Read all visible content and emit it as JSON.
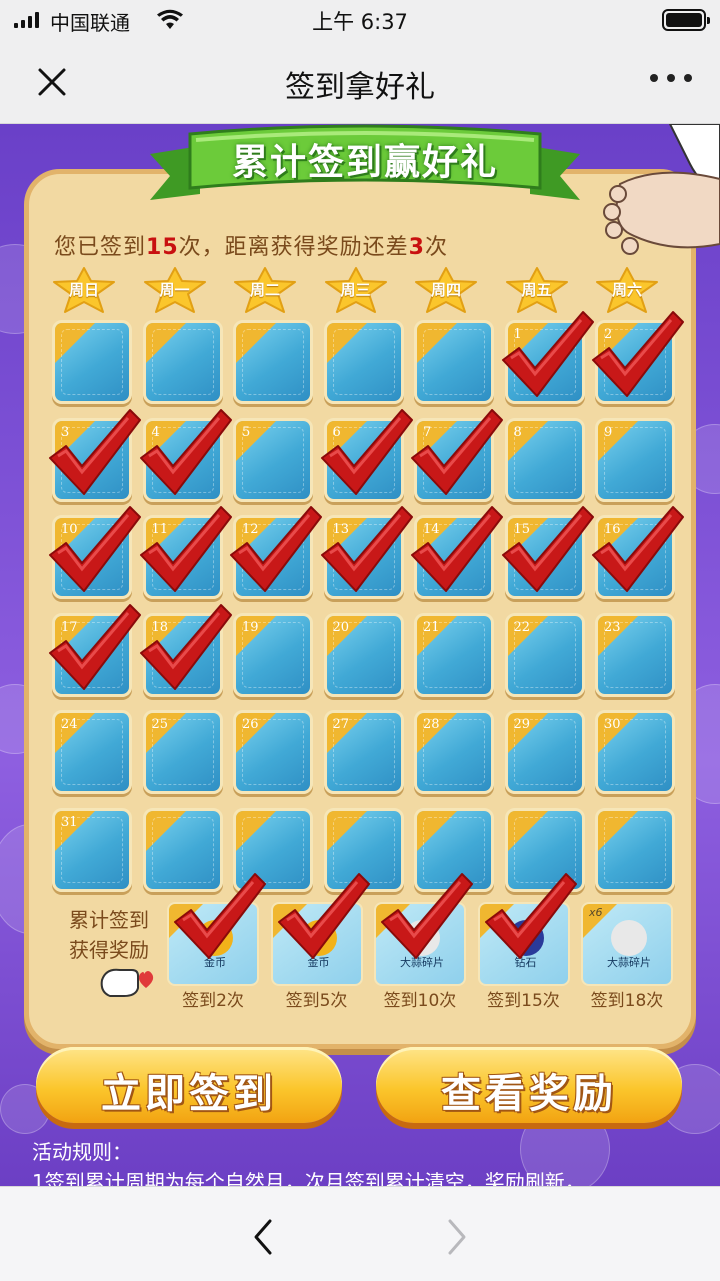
{
  "status_bar": {
    "carrier": "中国联通",
    "time": "上午 6:37"
  },
  "nav": {
    "title": "签到拿好礼",
    "close_icon": "close-icon",
    "more_icon": "more-icon"
  },
  "board": {
    "banner": "累计签到赢好礼",
    "signed_prefix": "您已签到",
    "signed_count": "15",
    "signed_mid": "次，距离获得奖励还差",
    "remaining": "3",
    "signed_suffix": "次"
  },
  "weekdays": [
    "周日",
    "周一",
    "周二",
    "周三",
    "周四",
    "周五",
    "周六"
  ],
  "calendar": {
    "leading_blank": 5,
    "days": 31,
    "checked_days": [
      1,
      2,
      3,
      4,
      6,
      7,
      10,
      11,
      12,
      13,
      14,
      15,
      16,
      17,
      18
    ]
  },
  "rewards": {
    "label_line1": "累计签到",
    "label_line2": "获得奖励",
    "items": [
      {
        "item": "金币",
        "caption": "签到2次",
        "claimed": true,
        "tag": ""
      },
      {
        "item": "金币",
        "caption": "签到5次",
        "claimed": true,
        "tag": ""
      },
      {
        "item": "大蒜碎片",
        "caption": "签到10次",
        "claimed": true,
        "tag": ""
      },
      {
        "item": "钻石",
        "caption": "签到15次",
        "claimed": true,
        "tag": ""
      },
      {
        "item": "大蒜碎片",
        "caption": "签到18次",
        "claimed": false,
        "tag": "x6"
      }
    ]
  },
  "buttons": {
    "checkin": "立即签到",
    "view_rewards": "查看奖励"
  },
  "rules": {
    "title": "活动规则：",
    "line1": "1签到累计周期为每个自然月，次月签到累计清空，奖励刷新，"
  },
  "colors": {
    "accent": "#fbc62c",
    "check": "#c81818",
    "cell": "#41a9d6",
    "ribbon": "#6ccb3a",
    "background": "#7b4fd4"
  }
}
